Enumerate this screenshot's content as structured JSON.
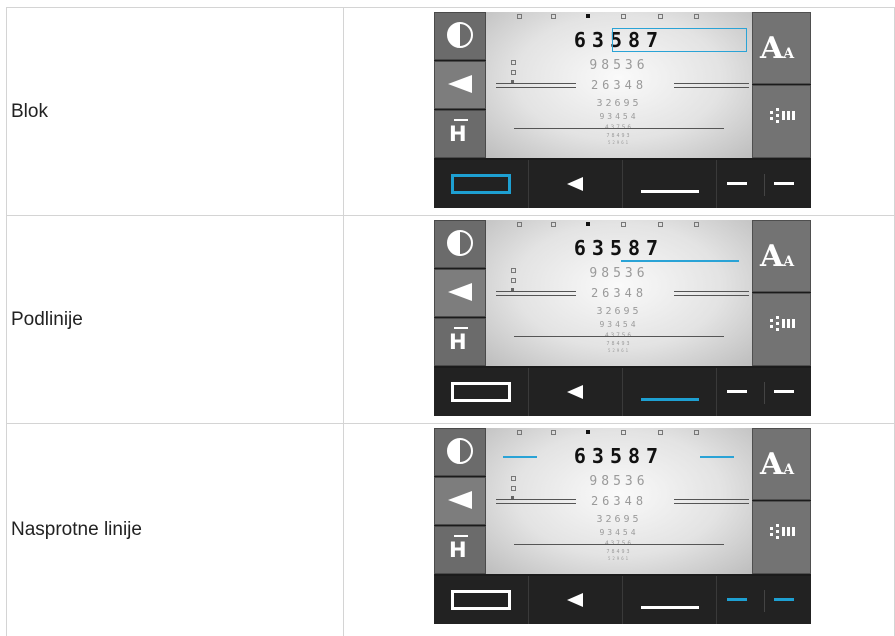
{
  "rows": [
    {
      "label": "Blok",
      "mode": "block"
    },
    {
      "label": "Podlinije",
      "mode": "underline"
    },
    {
      "label": "Nasprotne linije",
      "mode": "opposite"
    }
  ],
  "chart_screen": {
    "lines": [
      "63587",
      "98536",
      "26348",
      "32695",
      "93454",
      "43756",
      "78493",
      "52961"
    ]
  },
  "icons": {
    "left": [
      "contrast-icon",
      "triangle-left-icon",
      "h-bar-icon"
    ],
    "right": [
      "font-size-icon",
      "grid-icon"
    ],
    "bottom": [
      "rectangle-icon",
      "triangle-left-icon",
      "underline-icon",
      "opposite-lines-icon"
    ]
  },
  "font_icon": {
    "big": "A",
    "small": "A"
  },
  "h_icon": "H",
  "colors": {
    "accent": "#1ea0d2",
    "panel": "#6b6b6b",
    "dark": "#1c1c1c"
  }
}
